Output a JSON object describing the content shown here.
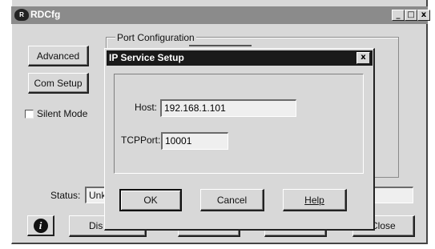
{
  "main_window": {
    "title": "RDCfg",
    "buttons": {
      "advanced": "Advanced",
      "com_setup": "Com Setup",
      "bottom_left": "Dis",
      "close": "Close"
    },
    "silent_mode": {
      "label": "Silent Mode",
      "checked": false
    },
    "port_config_label": "Port Configuration",
    "status_label": "Status:",
    "status_value": "Unkı",
    "titlebar_controls": {
      "minimize": "_",
      "maximize": "□",
      "close": "x"
    }
  },
  "dialog": {
    "title": "IP Service Setup",
    "close_glyph": "x",
    "host": {
      "label": "Host:",
      "value": "192.168.1.101"
    },
    "tcpport": {
      "label": "TCPPort:",
      "value": "10001"
    },
    "buttons": {
      "ok": "OK",
      "cancel": "Cancel",
      "help": "Help"
    }
  },
  "colors": {
    "titlebar": "#8b8b8b",
    "dialog_titlebar": "#1a1a1a",
    "face": "#d8d8d8"
  }
}
